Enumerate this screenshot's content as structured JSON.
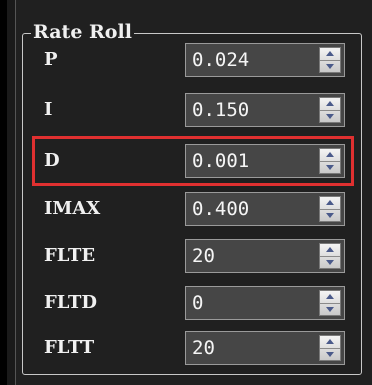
{
  "group": {
    "title": "Rate Roll"
  },
  "params": [
    {
      "label": "P",
      "value": "0.024"
    },
    {
      "label": "I",
      "value": "0.150"
    },
    {
      "label": "D",
      "value": "0.001"
    },
    {
      "label": "IMAX",
      "value": "0.400"
    },
    {
      "label": "FLTE",
      "value": "20"
    },
    {
      "label": "FLTD",
      "value": "0"
    },
    {
      "label": "FLTT",
      "value": "20"
    }
  ],
  "highlight": {
    "target": "D",
    "color": "#e03030"
  },
  "colors": {
    "background": "#202020",
    "field": "#464646",
    "text": "#f0f0f0"
  },
  "icons": {
    "spin_up": "arrow-up-icon",
    "spin_down": "arrow-down-icon"
  }
}
